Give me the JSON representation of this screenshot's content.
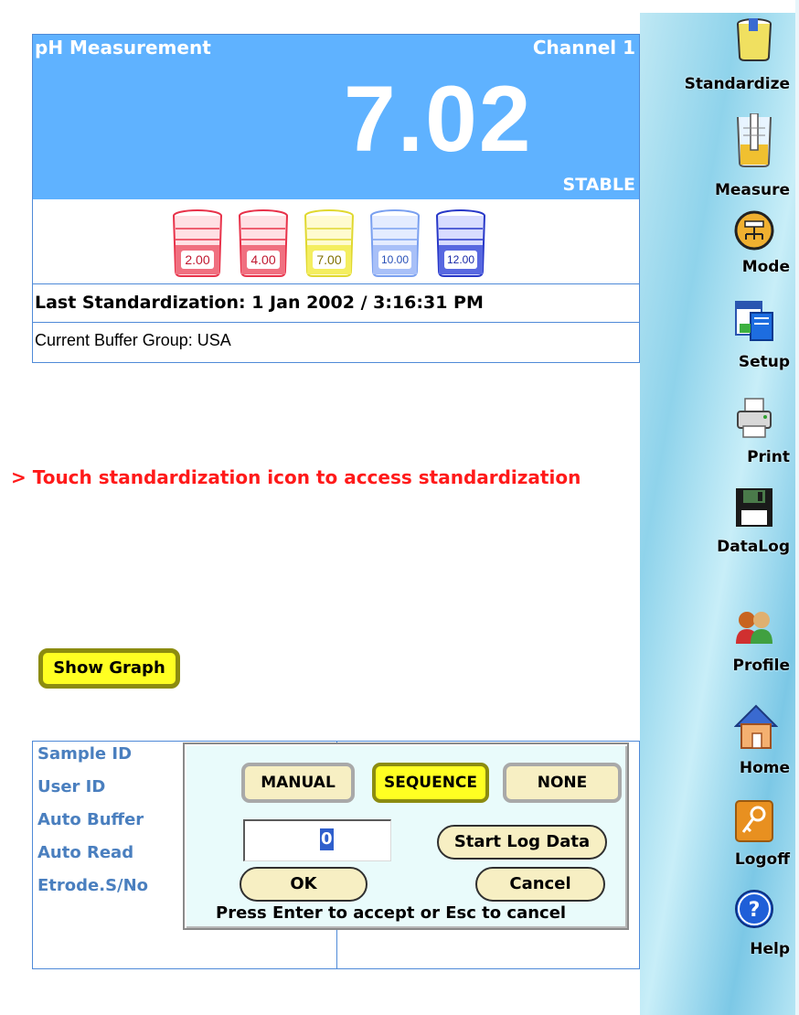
{
  "measurement": {
    "title": "pH Measurement",
    "channel": "Channel 1",
    "value": "7.02",
    "status": "STABLE",
    "beakers": [
      {
        "label": "2.00",
        "color": "#e8324a"
      },
      {
        "label": "4.00",
        "color": "#e8324a"
      },
      {
        "label": "7.00",
        "color": "#e8e832"
      },
      {
        "label": "10.00",
        "color": "#7aa0f0"
      },
      {
        "label": "12.00",
        "color": "#2838c8"
      }
    ],
    "last_standardization": "Last Standardization: 1 Jan 2002 / 3:16:31 PM",
    "buffer_group": "Current Buffer Group: USA"
  },
  "prompt": "> Touch standardization icon to access standardization",
  "show_graph_label": "Show Graph",
  "sample_fields": [
    "Sample ID",
    "User ID",
    "Auto Buffer",
    "Auto Read",
    "Etrode.S/No"
  ],
  "dialog": {
    "modes": [
      {
        "label": "MANUAL",
        "active": false
      },
      {
        "label": "SEQUENCE",
        "active": true
      },
      {
        "label": "NONE",
        "active": false
      }
    ],
    "input_value": "0",
    "start_log_label": "Start Log Data",
    "ok_label": "OK",
    "cancel_label": "Cancel",
    "hint": "Press  Enter to accept or Esc to cancel"
  },
  "toolbar": {
    "items": [
      {
        "label": "Standardize",
        "icon": "standardize-icon"
      },
      {
        "label": "Measure",
        "icon": "measure-icon"
      },
      {
        "label": "Mode",
        "icon": "mode-icon"
      },
      {
        "label": "Setup",
        "icon": "setup-icon"
      },
      {
        "label": "Print",
        "icon": "print-icon"
      },
      {
        "label": "DataLog",
        "icon": "datalog-icon"
      },
      {
        "label": "Profile",
        "icon": "profile-icon"
      },
      {
        "label": "Home",
        "icon": "home-icon"
      },
      {
        "label": "Logoff",
        "icon": "logoff-icon"
      },
      {
        "label": "Help",
        "icon": "help-icon"
      }
    ]
  },
  "colors": {
    "header_blue": "#5fb2ff",
    "prompt_red": "#ff1a1a",
    "highlight_yellow": "#ffff22"
  }
}
